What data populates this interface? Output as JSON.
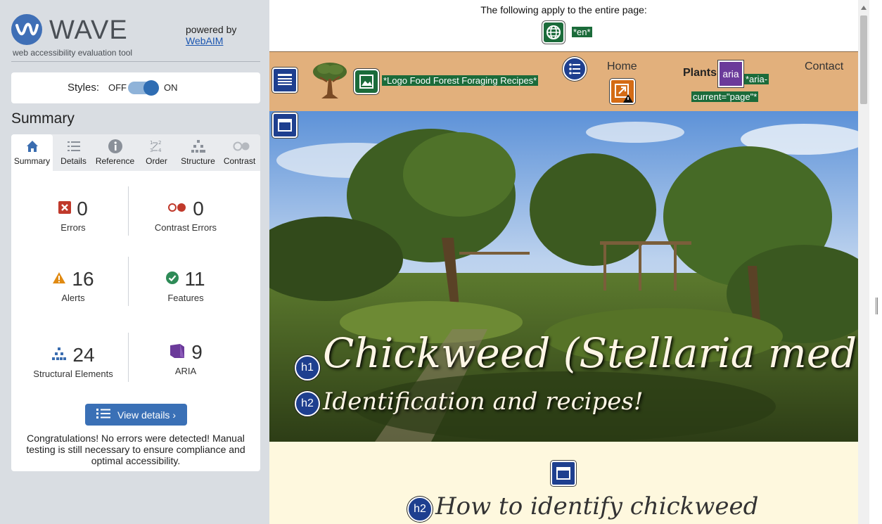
{
  "sidebar": {
    "brand": "WAVE",
    "tagline": "web accessibility evaluation tool",
    "powered_by": "powered by",
    "webaim_link": "WebAIM",
    "styles_label": "Styles:",
    "styles_off": "OFF",
    "styles_on": "ON",
    "summary_title": "Summary",
    "tabs": [
      {
        "label": "Summary",
        "icon": "home-icon"
      },
      {
        "label": "Details",
        "icon": "list-icon"
      },
      {
        "label": "Reference",
        "icon": "info-icon"
      },
      {
        "label": "Order",
        "icon": "order-icon"
      },
      {
        "label": "Structure",
        "icon": "structure-icon"
      },
      {
        "label": "Contrast",
        "icon": "contrast-icon"
      }
    ],
    "stats": {
      "errors": {
        "value": "0",
        "label": "Errors"
      },
      "contrast_errors": {
        "value": "0",
        "label": "Contrast Errors"
      },
      "alerts": {
        "value": "16",
        "label": "Alerts"
      },
      "features": {
        "value": "11",
        "label": "Features"
      },
      "structural": {
        "value": "24",
        "label": "Structural Elements"
      },
      "aria": {
        "value": "9",
        "label": "ARIA"
      }
    },
    "view_details": "View details ›",
    "congrats": "Congratulations! No errors were detected! Manual testing is still necessary to ensure compliance and optimal accessibility."
  },
  "page": {
    "top_notice": "The following apply to the entire page:",
    "lang_tag": "*en*",
    "logo_alt_tag": "*Logo Food Forest Foraging Recipes*",
    "nav": {
      "home": "Home",
      "plants": "Plants",
      "contact": "Contact"
    },
    "aria_badge": "aria",
    "aria_tag_1": "*aria-",
    "aria_tag_2": "current=\"page\"*",
    "h1_badge": "h1",
    "h2_badge": "h2",
    "hero_title": "Chickweed (Stellaria media)",
    "hero_subtitle": "Identification and recipes!",
    "section_badge": "h2",
    "section_title": "How to identify chickweed"
  },
  "colors": {
    "wave_blue": "#3f6fb6",
    "nav_bg": "#e2b07c",
    "content_bg": "#fef8de",
    "feature_green": "#1b6b3a",
    "structure_navy": "#1e3f8f",
    "alert_orange": "#d46b15",
    "aria_purple": "#6b3a9a",
    "error_red": "#c0392b"
  }
}
